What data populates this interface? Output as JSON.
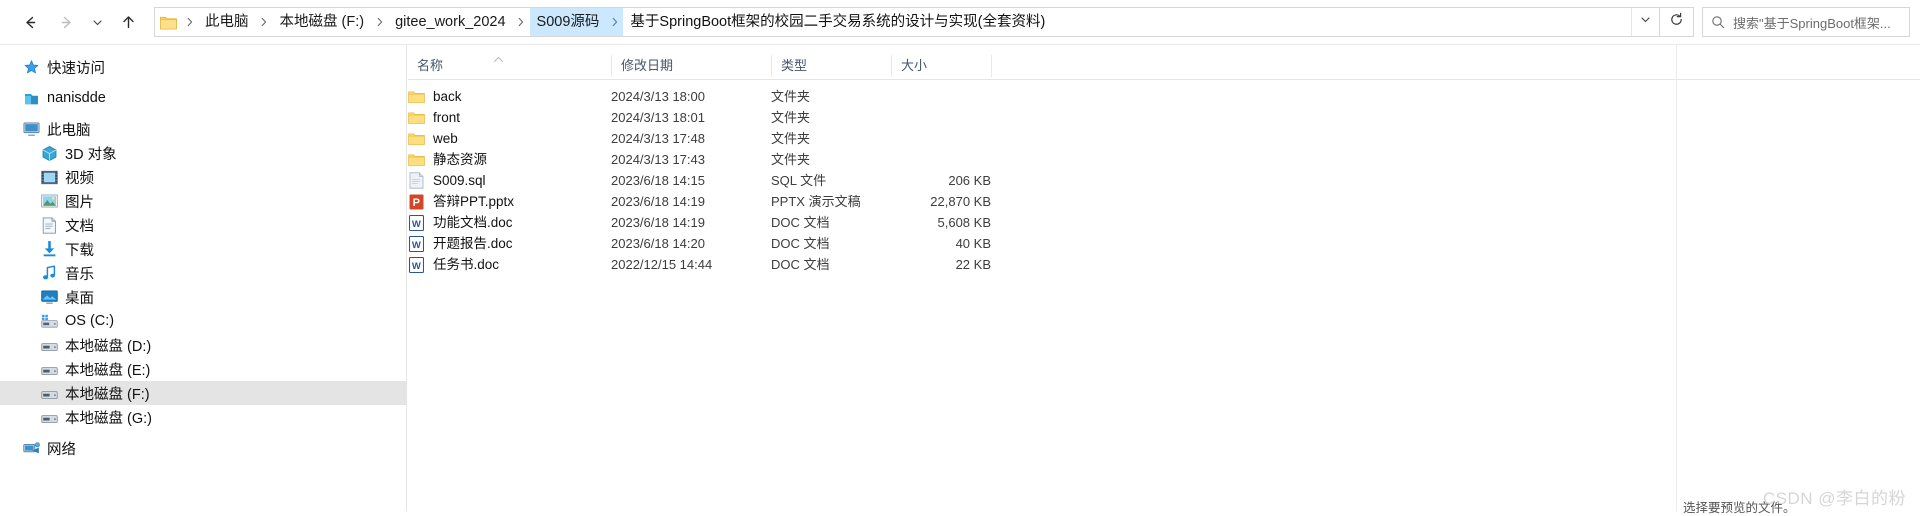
{
  "nav": {
    "back_label": "后退",
    "forward_label": "前进",
    "recent_label": "最近浏览的位置",
    "up_label": "上移到上一级",
    "refresh_label": "刷新",
    "back_icon": "arrow-left-icon",
    "forward_icon": "arrow-right-icon",
    "recent_icon": "chevron-down-icon",
    "up_icon": "arrow-up-icon",
    "refresh_icon": "refresh-icon"
  },
  "breadcrumb": {
    "folder_icon": "folder-icon",
    "separator": "›",
    "items": [
      {
        "label": "此电脑",
        "active": false
      },
      {
        "label": "本地磁盘 (F:)",
        "active": false
      },
      {
        "label": "gitee_work_2024",
        "active": false
      },
      {
        "label": "S009源码",
        "active": true
      },
      {
        "label": "基于SpringBoot框架的校园二手交易系统的设计与实现(全套资料)",
        "active": false
      }
    ],
    "dropdown_icon": "chevron-down-icon"
  },
  "search": {
    "placeholder": "搜索\"基于SpringBoot框架...",
    "icon": "search-icon"
  },
  "sidebar": {
    "items": [
      {
        "label": "快速访问",
        "icon": "star-pin-icon",
        "level": 0,
        "selected": false,
        "gap_after": true
      },
      {
        "label": "nanisdde",
        "icon": "onedrive-icon",
        "level": 0,
        "selected": false,
        "gap_after": true
      },
      {
        "label": "此电脑",
        "icon": "computer-icon",
        "level": 0,
        "selected": false,
        "gap_after": false
      },
      {
        "label": "3D 对象",
        "icon": "3d-objects-icon",
        "level": 1,
        "selected": false,
        "gap_after": false
      },
      {
        "label": "视频",
        "icon": "videos-icon",
        "level": 1,
        "selected": false,
        "gap_after": false
      },
      {
        "label": "图片",
        "icon": "pictures-icon",
        "level": 1,
        "selected": false,
        "gap_after": false
      },
      {
        "label": "文档",
        "icon": "documents-icon",
        "level": 1,
        "selected": false,
        "gap_after": false
      },
      {
        "label": "下载",
        "icon": "downloads-icon",
        "level": 1,
        "selected": false,
        "gap_after": false
      },
      {
        "label": "音乐",
        "icon": "music-icon",
        "level": 1,
        "selected": false,
        "gap_after": false
      },
      {
        "label": "桌面",
        "icon": "desktop-icon",
        "level": 1,
        "selected": false,
        "gap_after": false
      },
      {
        "label": "OS (C:)",
        "icon": "system-drive-icon",
        "level": 1,
        "selected": false,
        "gap_after": false
      },
      {
        "label": "本地磁盘 (D:)",
        "icon": "drive-icon",
        "level": 1,
        "selected": false,
        "gap_after": false
      },
      {
        "label": "本地磁盘 (E:)",
        "icon": "drive-icon",
        "level": 1,
        "selected": false,
        "gap_after": false
      },
      {
        "label": "本地磁盘 (F:)",
        "icon": "drive-icon",
        "level": 1,
        "selected": true,
        "gap_after": false
      },
      {
        "label": "本地磁盘 (G:)",
        "icon": "drive-icon",
        "level": 1,
        "selected": false,
        "gap_after": true
      },
      {
        "label": "网络",
        "icon": "network-icon",
        "level": 0,
        "selected": false,
        "gap_after": false
      }
    ]
  },
  "filelist": {
    "columns": [
      {
        "label": "名称",
        "sorted": true,
        "sort_dir": "asc"
      },
      {
        "label": "修改日期",
        "sorted": false
      },
      {
        "label": "类型",
        "sorted": false
      },
      {
        "label": "大小",
        "sorted": false
      }
    ],
    "sort_caret": "▲",
    "rows": [
      {
        "name": "back",
        "date": "2024/3/13 18:00",
        "type": "文件夹",
        "size": "",
        "icon": "folder-icon"
      },
      {
        "name": "front",
        "date": "2024/3/13 18:01",
        "type": "文件夹",
        "size": "",
        "icon": "folder-icon"
      },
      {
        "name": "web",
        "date": "2024/3/13 17:48",
        "type": "文件夹",
        "size": "",
        "icon": "folder-icon"
      },
      {
        "name": "静态资源",
        "date": "2024/3/13 17:43",
        "type": "文件夹",
        "size": "",
        "icon": "folder-icon"
      },
      {
        "name": "S009.sql",
        "date": "2023/6/18 14:15",
        "type": "SQL 文件",
        "size": "206 KB",
        "icon": "sql-file-icon"
      },
      {
        "name": "答辩PPT.pptx",
        "date": "2023/6/18 14:19",
        "type": "PPTX 演示文稿",
        "size": "22,870 KB",
        "icon": "powerpoint-icon"
      },
      {
        "name": "功能文档.doc",
        "date": "2023/6/18 14:19",
        "type": "DOC 文档",
        "size": "5,608 KB",
        "icon": "word-icon"
      },
      {
        "name": "开题报告.doc",
        "date": "2023/6/18 14:20",
        "type": "DOC 文档",
        "size": "40 KB",
        "icon": "word-icon"
      },
      {
        "name": "任务书.doc",
        "date": "2022/12/15 14:44",
        "type": "DOC 文档",
        "size": "22 KB",
        "icon": "word-icon"
      }
    ]
  },
  "preview": {
    "empty_text": "选择要预览的文件。"
  },
  "watermark": {
    "text": "CSDN @李白的粉"
  },
  "colors": {
    "selection": "#cce8ff",
    "sidebar_selected": "#e4e4e4",
    "folder": "#ffd65c",
    "word": "#2b579a",
    "powerpoint": "#d24726",
    "header_text": "#46566b"
  }
}
